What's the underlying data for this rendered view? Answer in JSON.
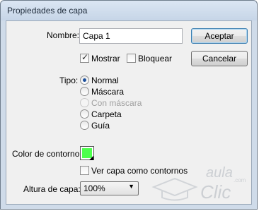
{
  "window": {
    "title": "Propiedades de capa"
  },
  "name": {
    "label": "Nombre:",
    "value": "Capa 1"
  },
  "buttons": {
    "ok": "Aceptar",
    "cancel": "Cancelar"
  },
  "options": {
    "show": "Mostrar",
    "show_checked": true,
    "lock": "Bloquear",
    "lock_checked": false
  },
  "type": {
    "label": "Tipo:",
    "items": [
      "Normal",
      "Máscara",
      "Con máscara",
      "Carpeta",
      "Guía"
    ],
    "selected": "Normal"
  },
  "outline": {
    "label": "Color de contorno:",
    "color": "#4dff4d",
    "view_outline_label": "Ver capa como contornos",
    "view_outline_checked": false
  },
  "height": {
    "label": "Altura de capa:",
    "value": "100%"
  },
  "watermark": {
    "line1": "aula",
    "line2": "Clic",
    "suffix": ".com"
  }
}
